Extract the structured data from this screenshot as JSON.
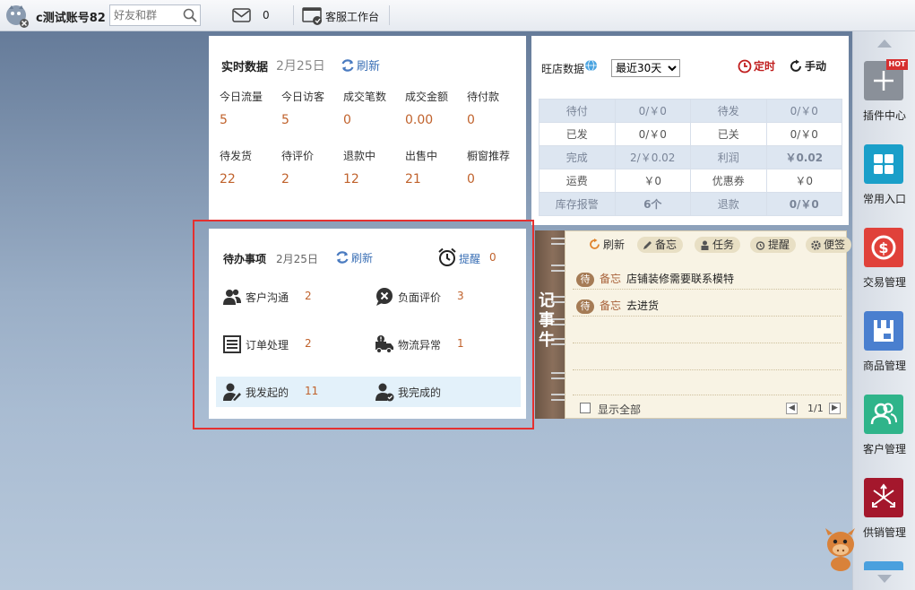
{
  "topbar": {
    "account": "c测试账号82",
    "search_placeholder": "好友和群",
    "mail_count": "0",
    "workspace_label": "客服工作台"
  },
  "realtime": {
    "title": "实时数据",
    "date": "2月25日",
    "refresh": "刷新",
    "stats": [
      {
        "label": "今日流量",
        "value": "5"
      },
      {
        "label": "今日访客",
        "value": "5"
      },
      {
        "label": "成交笔数",
        "value": "0"
      },
      {
        "label": "成交金额",
        "value": "0.00"
      },
      {
        "label": "待付款",
        "value": "0"
      },
      {
        "label": "待发货",
        "value": "22"
      },
      {
        "label": "待评价",
        "value": "2"
      },
      {
        "label": "退款中",
        "value": "12"
      },
      {
        "label": "出售中",
        "value": "21"
      },
      {
        "label": "橱窗推荐",
        "value": "0"
      }
    ]
  },
  "wangdian": {
    "title": "旺店数据",
    "range_selected": "最近30天",
    "timer": "定时",
    "manual": "手动",
    "rows": [
      [
        "待付",
        "0/￥0",
        "待发",
        "0/￥0"
      ],
      [
        "已发",
        "0/￥0",
        "已关",
        "0/￥0"
      ],
      [
        "完成",
        "2/￥0.02",
        "利润",
        "￥0.02"
      ],
      [
        "运费",
        "￥0",
        "优惠券",
        "￥0"
      ],
      [
        "库存报警",
        "6个",
        "退款",
        "0/￥0"
      ]
    ]
  },
  "todo": {
    "title": "待办事项",
    "date": "2月25日",
    "refresh": "刷新",
    "remind": "提醒",
    "remind_count": "0",
    "items": [
      {
        "label": "客户沟通",
        "count": "2"
      },
      {
        "label": "负面评价",
        "count": "3"
      },
      {
        "label": "订单处理",
        "count": "2"
      },
      {
        "label": "物流异常",
        "count": "1"
      },
      {
        "label": "我发起的",
        "count": "11"
      },
      {
        "label": "我完成的",
        "count": ""
      }
    ]
  },
  "notebook": {
    "spine_title": "记事牛",
    "tools": [
      "刷新",
      "备忘",
      "任务",
      "提醒",
      "便签"
    ],
    "memos": [
      {
        "badge": "待",
        "tag": "备忘",
        "text": "店铺装修需要联系模特"
      },
      {
        "badge": "待",
        "tag": "备忘",
        "text": "去进货"
      }
    ],
    "show_all": "显示全部",
    "page": "1/1"
  },
  "sidebar": {
    "items": [
      {
        "label": "插件中心",
        "color": "#8a9099",
        "badge": "HOT"
      },
      {
        "label": "常用入口",
        "color": "#1a9fc9"
      },
      {
        "label": "交易管理",
        "color": "#e0413a"
      },
      {
        "label": "商品管理",
        "color": "#4a7fcf"
      },
      {
        "label": "客户管理",
        "color": "#2fb48a"
      },
      {
        "label": "供销管理",
        "color": "#a4172c"
      }
    ]
  }
}
